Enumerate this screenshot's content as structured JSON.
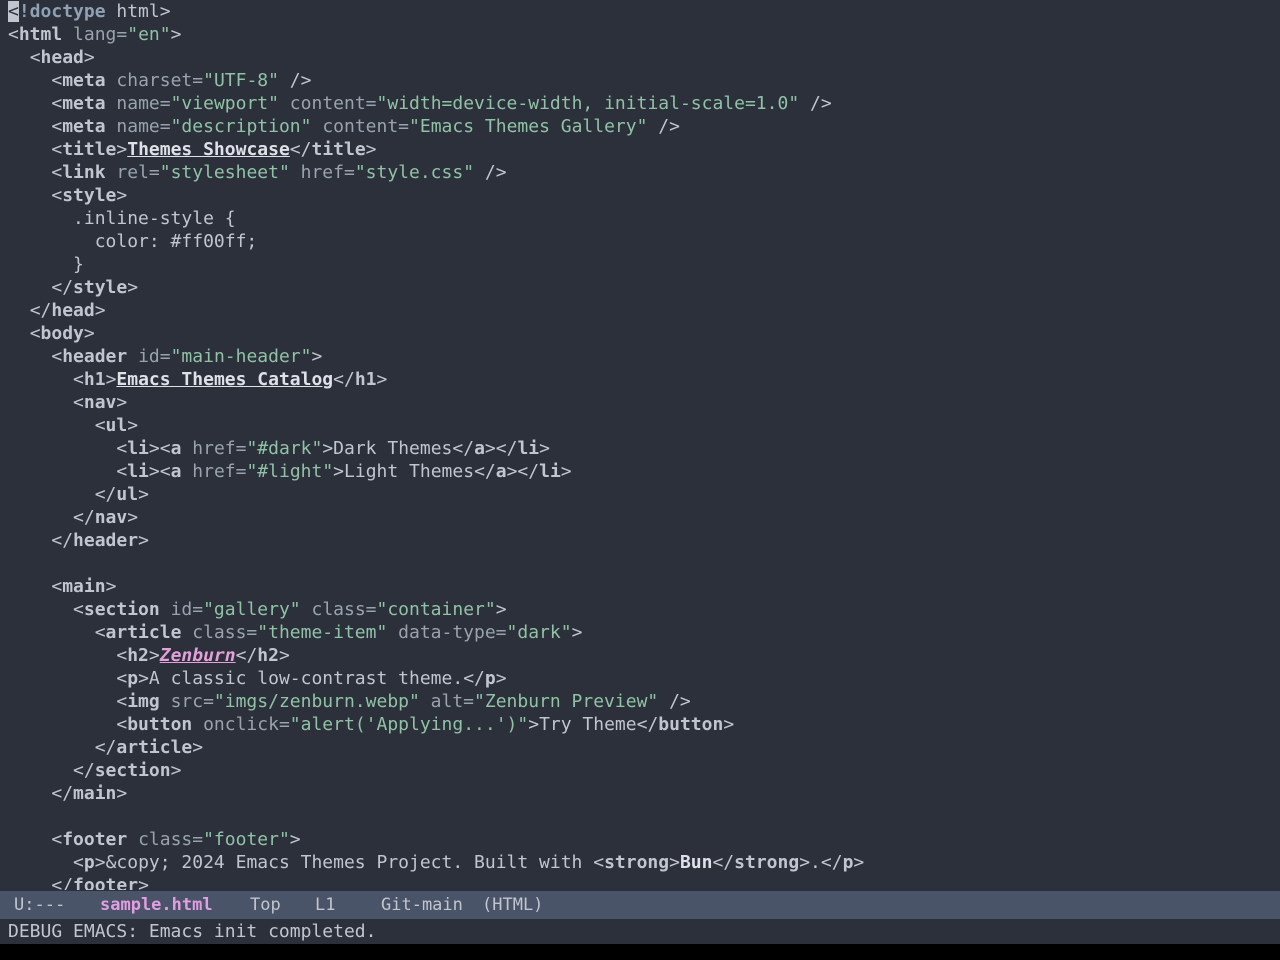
{
  "editor": {
    "lines": [
      [
        [
          "cur",
          "<"
        ],
        [
          "dt",
          "!doctype"
        ],
        [
          "txt",
          " html>"
        ]
      ],
      [
        [
          "tg",
          "<"
        ],
        [
          "tn",
          "html"
        ],
        [
          "an",
          " lang="
        ],
        [
          "sv",
          "\"en\""
        ],
        [
          "tg",
          ">"
        ]
      ],
      [
        [
          "txt",
          "  "
        ],
        [
          "tg",
          "<"
        ],
        [
          "tn",
          "head"
        ],
        [
          "tg",
          ">"
        ]
      ],
      [
        [
          "txt",
          "    "
        ],
        [
          "tg",
          "<"
        ],
        [
          "tn",
          "meta"
        ],
        [
          "an",
          " charset="
        ],
        [
          "sv",
          "\"UTF-8\""
        ],
        [
          "tg",
          " />"
        ]
      ],
      [
        [
          "txt",
          "    "
        ],
        [
          "tg",
          "<"
        ],
        [
          "tn",
          "meta"
        ],
        [
          "an",
          " name="
        ],
        [
          "sv",
          "\"viewport\""
        ],
        [
          "an",
          " content="
        ],
        [
          "sv",
          "\"width=device-width, initial-scale=1.0\""
        ],
        [
          "tg",
          " />"
        ]
      ],
      [
        [
          "txt",
          "    "
        ],
        [
          "tg",
          "<"
        ],
        [
          "tn",
          "meta"
        ],
        [
          "an",
          " name="
        ],
        [
          "sv",
          "\"description\""
        ],
        [
          "an",
          " content="
        ],
        [
          "sv",
          "\"Emacs Themes Gallery\""
        ],
        [
          "tg",
          " />"
        ]
      ],
      [
        [
          "txt",
          "    "
        ],
        [
          "tg",
          "<"
        ],
        [
          "tn",
          "title"
        ],
        [
          "tg",
          ">"
        ],
        [
          "ti",
          "Themes Showcase"
        ],
        [
          "tg",
          "</"
        ],
        [
          "tn",
          "title"
        ],
        [
          "tg",
          ">"
        ]
      ],
      [
        [
          "txt",
          "    "
        ],
        [
          "tg",
          "<"
        ],
        [
          "tn",
          "link"
        ],
        [
          "an",
          " rel="
        ],
        [
          "sv",
          "\"stylesheet\""
        ],
        [
          "an",
          " href="
        ],
        [
          "sv",
          "\"style.css\""
        ],
        [
          "tg",
          " />"
        ]
      ],
      [
        [
          "txt",
          "    "
        ],
        [
          "tg",
          "<"
        ],
        [
          "tn",
          "style"
        ],
        [
          "tg",
          ">"
        ]
      ],
      [
        [
          "txt",
          "      .inline-style {"
        ]
      ],
      [
        [
          "txt",
          "        color: #ff00ff;"
        ]
      ],
      [
        [
          "txt",
          "      }"
        ]
      ],
      [
        [
          "txt",
          "    "
        ],
        [
          "tg",
          "</"
        ],
        [
          "tn",
          "style"
        ],
        [
          "tg",
          ">"
        ]
      ],
      [
        [
          "txt",
          "  "
        ],
        [
          "tg",
          "</"
        ],
        [
          "tn",
          "head"
        ],
        [
          "tg",
          ">"
        ]
      ],
      [
        [
          "txt",
          "  "
        ],
        [
          "tg",
          "<"
        ],
        [
          "tn",
          "body"
        ],
        [
          "tg",
          ">"
        ]
      ],
      [
        [
          "txt",
          "    "
        ],
        [
          "tg",
          "<"
        ],
        [
          "tn",
          "header"
        ],
        [
          "an",
          " id="
        ],
        [
          "sv",
          "\"main-header\""
        ],
        [
          "tg",
          ">"
        ]
      ],
      [
        [
          "txt",
          "      "
        ],
        [
          "tg",
          "<"
        ],
        [
          "tn",
          "h1"
        ],
        [
          "tg",
          ">"
        ],
        [
          "ti",
          "Emacs Themes Catalog"
        ],
        [
          "tg",
          "</"
        ],
        [
          "tn",
          "h1"
        ],
        [
          "tg",
          ">"
        ]
      ],
      [
        [
          "txt",
          "      "
        ],
        [
          "tg",
          "<"
        ],
        [
          "tn",
          "nav"
        ],
        [
          "tg",
          ">"
        ]
      ],
      [
        [
          "txt",
          "        "
        ],
        [
          "tg",
          "<"
        ],
        [
          "tn",
          "ul"
        ],
        [
          "tg",
          ">"
        ]
      ],
      [
        [
          "txt",
          "          "
        ],
        [
          "tg",
          "<"
        ],
        [
          "tn",
          "li"
        ],
        [
          "tg",
          "><"
        ],
        [
          "tn",
          "a"
        ],
        [
          "an",
          " href="
        ],
        [
          "sv",
          "\"#dark\""
        ],
        [
          "tg",
          ">"
        ],
        [
          "txt",
          "Dark Themes"
        ],
        [
          "tg",
          "</"
        ],
        [
          "tn",
          "a"
        ],
        [
          "tg",
          "></"
        ],
        [
          "tn",
          "li"
        ],
        [
          "tg",
          ">"
        ]
      ],
      [
        [
          "txt",
          "          "
        ],
        [
          "tg",
          "<"
        ],
        [
          "tn",
          "li"
        ],
        [
          "tg",
          "><"
        ],
        [
          "tn",
          "a"
        ],
        [
          "an",
          " href="
        ],
        [
          "sv",
          "\"#light\""
        ],
        [
          "tg",
          ">"
        ],
        [
          "txt",
          "Light Themes"
        ],
        [
          "tg",
          "</"
        ],
        [
          "tn",
          "a"
        ],
        [
          "tg",
          "></"
        ],
        [
          "tn",
          "li"
        ],
        [
          "tg",
          ">"
        ]
      ],
      [
        [
          "txt",
          "        "
        ],
        [
          "tg",
          "</"
        ],
        [
          "tn",
          "ul"
        ],
        [
          "tg",
          ">"
        ]
      ],
      [
        [
          "txt",
          "      "
        ],
        [
          "tg",
          "</"
        ],
        [
          "tn",
          "nav"
        ],
        [
          "tg",
          ">"
        ]
      ],
      [
        [
          "txt",
          "    "
        ],
        [
          "tg",
          "</"
        ],
        [
          "tn",
          "header"
        ],
        [
          "tg",
          ">"
        ]
      ],
      [],
      [
        [
          "txt",
          "    "
        ],
        [
          "tg",
          "<"
        ],
        [
          "tn",
          "main"
        ],
        [
          "tg",
          ">"
        ]
      ],
      [
        [
          "txt",
          "      "
        ],
        [
          "tg",
          "<"
        ],
        [
          "tn",
          "section"
        ],
        [
          "an",
          " id="
        ],
        [
          "sv",
          "\"gallery\""
        ],
        [
          "an",
          " class="
        ],
        [
          "sv",
          "\"container\""
        ],
        [
          "tg",
          ">"
        ]
      ],
      [
        [
          "txt",
          "        "
        ],
        [
          "tg",
          "<"
        ],
        [
          "tn",
          "article"
        ],
        [
          "an",
          " class="
        ],
        [
          "sv",
          "\"theme-item\""
        ],
        [
          "an",
          " data-type="
        ],
        [
          "sv",
          "\"dark\""
        ],
        [
          "tg",
          ">"
        ]
      ],
      [
        [
          "txt",
          "          "
        ],
        [
          "tg",
          "<"
        ],
        [
          "tn",
          "h2"
        ],
        [
          "tg",
          ">"
        ],
        [
          "h2t",
          "Zenburn"
        ],
        [
          "tg",
          "</"
        ],
        [
          "tn",
          "h2"
        ],
        [
          "tg",
          ">"
        ]
      ],
      [
        [
          "txt",
          "          "
        ],
        [
          "tg",
          "<"
        ],
        [
          "tn",
          "p"
        ],
        [
          "tg",
          ">"
        ],
        [
          "txt",
          "A classic low-contrast theme."
        ],
        [
          "tg",
          "</"
        ],
        [
          "tn",
          "p"
        ],
        [
          "tg",
          ">"
        ]
      ],
      [
        [
          "txt",
          "          "
        ],
        [
          "tg",
          "<"
        ],
        [
          "tn",
          "img"
        ],
        [
          "an",
          " src="
        ],
        [
          "sv",
          "\"imgs/zenburn.webp\""
        ],
        [
          "an",
          " alt="
        ],
        [
          "sv",
          "\"Zenburn Preview\""
        ],
        [
          "tg",
          " />"
        ]
      ],
      [
        [
          "txt",
          "          "
        ],
        [
          "tg",
          "<"
        ],
        [
          "tn",
          "button"
        ],
        [
          "an",
          " onclick="
        ],
        [
          "sv",
          "\"alert('Applying...')\""
        ],
        [
          "tg",
          ">"
        ],
        [
          "txt",
          "Try Theme"
        ],
        [
          "tg",
          "</"
        ],
        [
          "tn",
          "button"
        ],
        [
          "tg",
          ">"
        ]
      ],
      [
        [
          "txt",
          "        "
        ],
        [
          "tg",
          "</"
        ],
        [
          "tn",
          "article"
        ],
        [
          "tg",
          ">"
        ]
      ],
      [
        [
          "txt",
          "      "
        ],
        [
          "tg",
          "</"
        ],
        [
          "tn",
          "section"
        ],
        [
          "tg",
          ">"
        ]
      ],
      [
        [
          "txt",
          "    "
        ],
        [
          "tg",
          "</"
        ],
        [
          "tn",
          "main"
        ],
        [
          "tg",
          ">"
        ]
      ],
      [],
      [
        [
          "txt",
          "    "
        ],
        [
          "tg",
          "<"
        ],
        [
          "tn",
          "footer"
        ],
        [
          "an",
          " class="
        ],
        [
          "sv",
          "\"footer\""
        ],
        [
          "tg",
          ">"
        ]
      ],
      [
        [
          "txt",
          "      "
        ],
        [
          "tg",
          "<"
        ],
        [
          "tn",
          "p"
        ],
        [
          "tg",
          ">"
        ],
        [
          "txt",
          "&copy; 2024 Emacs Themes Project. Built with "
        ],
        [
          "tg",
          "<"
        ],
        [
          "tn",
          "strong"
        ],
        [
          "tg",
          ">"
        ],
        [
          "st",
          "Bun"
        ],
        [
          "tg",
          "</"
        ],
        [
          "tn",
          "strong"
        ],
        [
          "tg",
          ">"
        ],
        [
          "txt",
          "."
        ],
        [
          "tg",
          "</"
        ],
        [
          "tn",
          "p"
        ],
        [
          "tg",
          ">"
        ]
      ],
      [
        [
          "txt",
          "    "
        ],
        [
          "tg",
          "</"
        ],
        [
          "tn",
          "footer"
        ],
        [
          "tg",
          ">"
        ]
      ]
    ]
  },
  "modeline": {
    "state": "U:---",
    "buffer_name": "sample.html",
    "position": "Top",
    "line": "L1",
    "vc": "Git-main",
    "mode": "(HTML)"
  },
  "echo_area": {
    "message": "DEBUG EMACS: Emacs init completed."
  },
  "colors": {
    "background": "#2b303b",
    "modeline_bg": "#4a5468",
    "buffer_name": "#e39ee0",
    "string": "#90c3a5"
  }
}
